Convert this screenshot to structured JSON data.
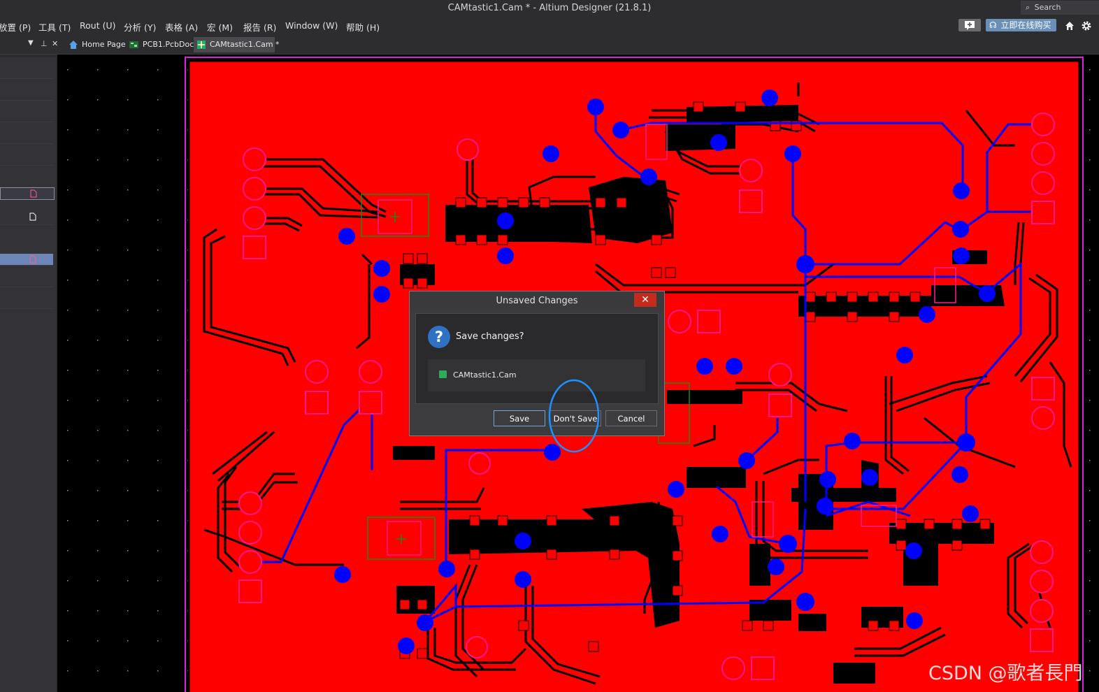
{
  "window": {
    "title": "CAMtastic1.Cam * - Altium Designer (21.8.1)",
    "search_label": "Search"
  },
  "menubar": {
    "items": [
      "放置 (P)",
      "工具 (T)",
      "Rout (U)",
      "分析 (Y)",
      "表格 (A)",
      "宏 (M)",
      "报告 (R)",
      "Window (W)",
      "帮助 (H)"
    ],
    "buy_label": "立即在线购买"
  },
  "tabs": [
    {
      "label": "Home Page",
      "icon": "home-icon"
    },
    {
      "label": "PCB1.PcbDoc",
      "icon": "pcb-doc-icon"
    },
    {
      "label": "CAMtastic1.Cam *",
      "icon": "cam-doc-icon",
      "active": true
    }
  ],
  "dialog": {
    "title": "Unsaved Changes",
    "close_label": "✕",
    "question": "Save changes?",
    "file": "CAMtastic1.Cam",
    "buttons": {
      "save": "Save",
      "dont_save": "Don't Save",
      "cancel": "Cancel"
    }
  },
  "watermark": "CSDN @歌者長門",
  "colors": {
    "board": "#ff0000",
    "copper": "#000000",
    "top_layer_trace": "#0000ff",
    "pad_outline": "#ff1a8c",
    "board_outline": "#e01ee0",
    "component_outline": "#1a8a1a",
    "highlight_circle": "#1e90ff",
    "accent": "#2f72c4"
  }
}
